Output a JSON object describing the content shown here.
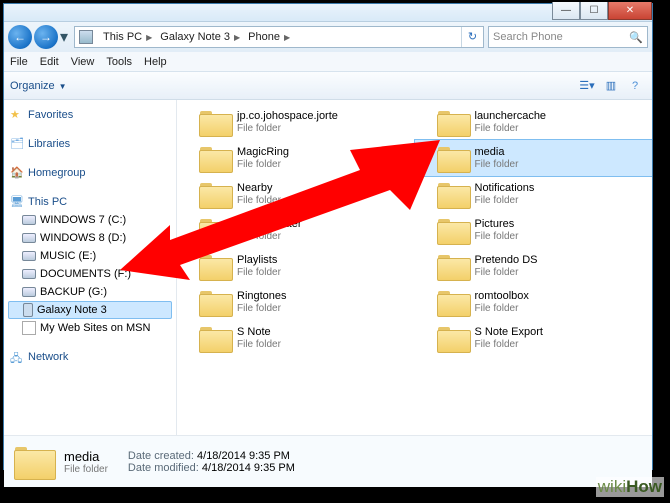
{
  "window_controls": {
    "min": "—",
    "max": "☐",
    "close": "✕"
  },
  "breadcrumb": [
    "This PC",
    "Galaxy Note 3",
    "Phone"
  ],
  "search_placeholder": "Search Phone",
  "menu": [
    "File",
    "Edit",
    "View",
    "Tools",
    "Help"
  ],
  "toolbar": {
    "organize": "Organize"
  },
  "nav": {
    "favorites": "Favorites",
    "libraries": "Libraries",
    "homegroup": "Homegroup",
    "thispc": "This PC",
    "drives": [
      "WINDOWS 7 (C:)",
      "WINDOWS 8 (D:)",
      "MUSIC (E:)",
      "DOCUMENTS (F:)",
      "BACKUP (G:)"
    ],
    "phone": "Galaxy Note 3",
    "msn": "My Web Sites on MSN",
    "network": "Network"
  },
  "subtype": "File folder",
  "folders_left": [
    "jp.co.johospace.jorte",
    "MagicRing",
    "Nearby",
    "OTA-Updater",
    "Playlists",
    "Ringtones",
    "S Note"
  ],
  "folders_right": [
    "launchercache",
    "media",
    "Notifications",
    "Pictures",
    "Pretendo DS",
    "romtoolbox",
    "S Note Export"
  ],
  "selected": "media",
  "details": {
    "name": "media",
    "type": "File folder",
    "created_lbl": "Date created:",
    "created": "4/18/2014 9:35 PM",
    "modified_lbl": "Date modified:",
    "modified": "4/18/2014 9:35 PM"
  },
  "watermark": {
    "w": "wiki",
    "h": "How"
  }
}
